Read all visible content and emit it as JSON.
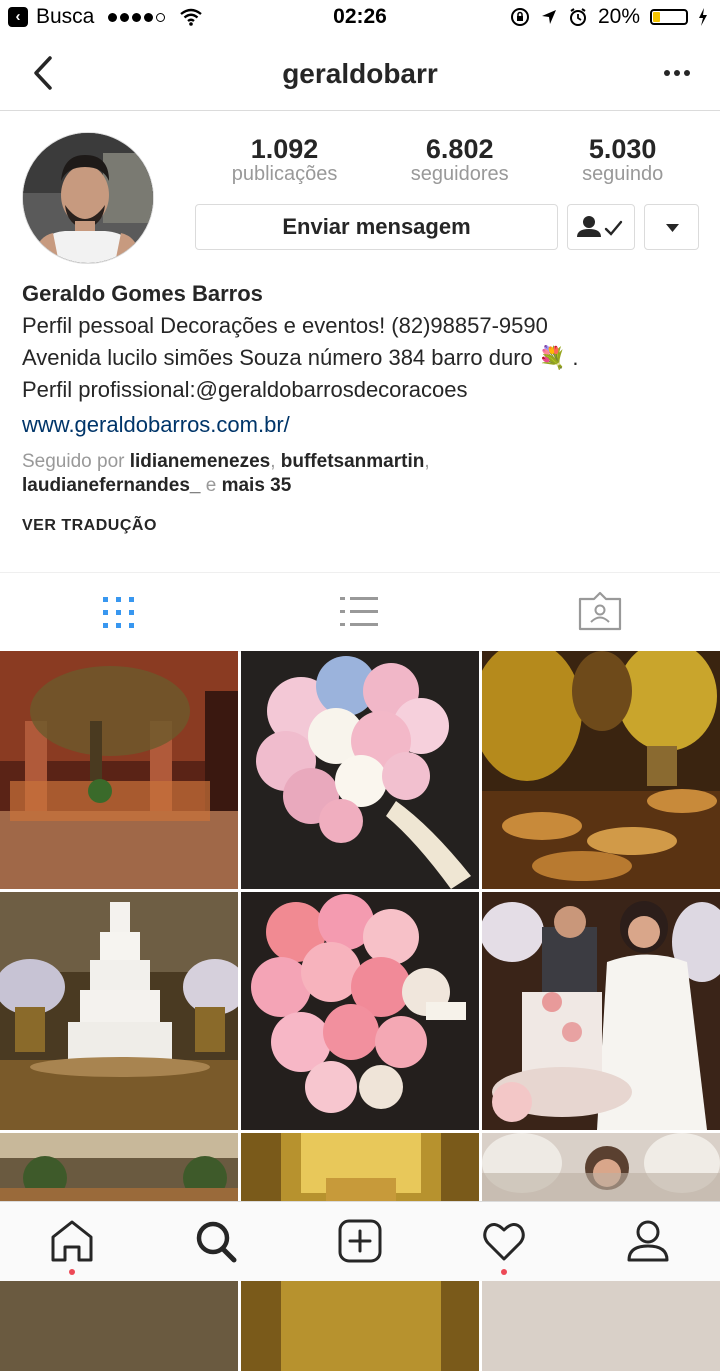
{
  "status_bar": {
    "back_app": "Busca",
    "time": "02:26",
    "battery": "20%"
  },
  "nav": {
    "title": "geraldobarr"
  },
  "stats": [
    {
      "value": "1.092",
      "label": "publicações"
    },
    {
      "value": "6.802",
      "label": "seguidores"
    },
    {
      "value": "5.030",
      "label": "seguindo"
    }
  ],
  "actions": {
    "message_label": "Enviar mensagem"
  },
  "bio": {
    "name": "Geraldo Gomes Barros",
    "line1": "Perfil pessoal Decorações e eventos! (82)98857-9590",
    "line2": "Avenida lucilo simões Souza número 384 barro duro 💐 .",
    "line3": "Perfil profissional:@geraldobarrosdecoracoes",
    "website": "www.geraldobarros.com.br/"
  },
  "followed_by": {
    "prefix": "Seguido por",
    "user1": "lidianemenezes",
    "sep1": ",",
    "user2": "buffetsanmartin",
    "sep2": ",",
    "user3": "laudianefernandes_",
    "conj": "e",
    "more": "mais 35"
  },
  "translate_label": "VER TRADUÇÃO",
  "tabs": [
    "grid",
    "list",
    "tagged"
  ],
  "colors": {
    "accent": "#3897f0",
    "link": "#003569",
    "notification": "#ed4956"
  },
  "icons": {
    "nav_back": "chevron-left-icon",
    "more": "more-icon",
    "follow": "following-check-icon",
    "dropdown": "triangle-down-icon",
    "home": "home-icon",
    "search": "search-icon",
    "add": "add-post-icon",
    "activity": "heart-icon",
    "profile": "profile-icon"
  }
}
